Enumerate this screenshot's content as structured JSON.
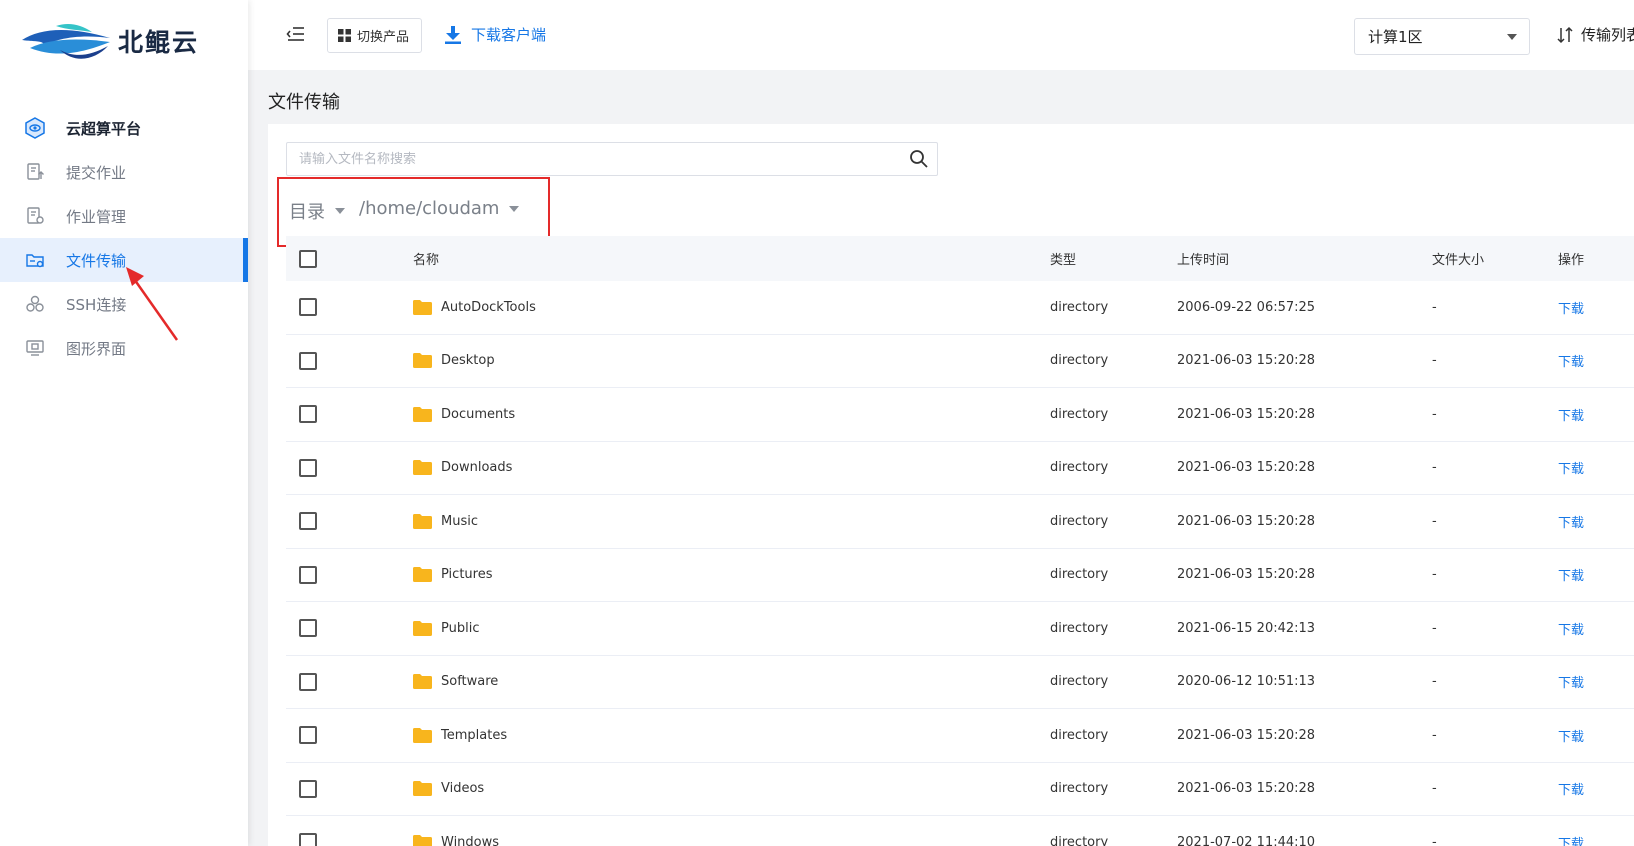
{
  "sidebar": {
    "logo_text": "北鲲云",
    "items": [
      {
        "label": "云超算平台",
        "icon": "platform-hex-icon"
      },
      {
        "label": "提交作业",
        "icon": "submit-job-icon"
      },
      {
        "label": "作业管理",
        "icon": "job-manage-icon"
      },
      {
        "label": "文件传输",
        "icon": "file-transfer-icon"
      },
      {
        "label": "SSH连接",
        "icon": "ssh-nodes-icon"
      },
      {
        "label": "图形界面",
        "icon": "monitor-icon"
      }
    ],
    "active_index": 3
  },
  "topbar": {
    "switch_label": "切换产品",
    "download_client_label": "下载客户端",
    "zone_value": "计算1区",
    "transfer_list_label": "传输列表"
  },
  "page": {
    "title": "文件传输",
    "search_placeholder": "请输入文件名称搜索",
    "path_root": "目录",
    "path_current": "/home/cloudam"
  },
  "table": {
    "headers": {
      "name": "名称",
      "type": "类型",
      "time": "上传时间",
      "size": "文件大小",
      "op": "操作"
    },
    "rows": [
      {
        "name": "AutoDockTools",
        "type": "directory",
        "time": "2006-09-22 06:57:25",
        "size": "-",
        "op": "下载"
      },
      {
        "name": "Desktop",
        "type": "directory",
        "time": "2021-06-03 15:20:28",
        "size": "-",
        "op": "下载"
      },
      {
        "name": "Documents",
        "type": "directory",
        "time": "2021-06-03 15:20:28",
        "size": "-",
        "op": "下载"
      },
      {
        "name": "Downloads",
        "type": "directory",
        "time": "2021-06-03 15:20:28",
        "size": "-",
        "op": "下载"
      },
      {
        "name": "Music",
        "type": "directory",
        "time": "2021-06-03 15:20:28",
        "size": "-",
        "op": "下载"
      },
      {
        "name": "Pictures",
        "type": "directory",
        "time": "2021-06-03 15:20:28",
        "size": "-",
        "op": "下载"
      },
      {
        "name": "Public",
        "type": "directory",
        "time": "2021-06-15 20:42:13",
        "size": "-",
        "op": "下载"
      },
      {
        "name": "Software",
        "type": "directory",
        "time": "2020-06-12 10:51:13",
        "size": "-",
        "op": "下载"
      },
      {
        "name": "Templates",
        "type": "directory",
        "time": "2021-06-03 15:20:28",
        "size": "-",
        "op": "下载"
      },
      {
        "name": "Videos",
        "type": "directory",
        "time": "2021-06-03 15:20:28",
        "size": "-",
        "op": "下载"
      },
      {
        "name": "Windows",
        "type": "directory",
        "time": "2021-07-02 11:44:10",
        "size": "-",
        "op": "下载"
      }
    ]
  },
  "colors": {
    "accent": "#1677e6",
    "annotation": "#e42a2a",
    "folder": "#f8b51d"
  }
}
